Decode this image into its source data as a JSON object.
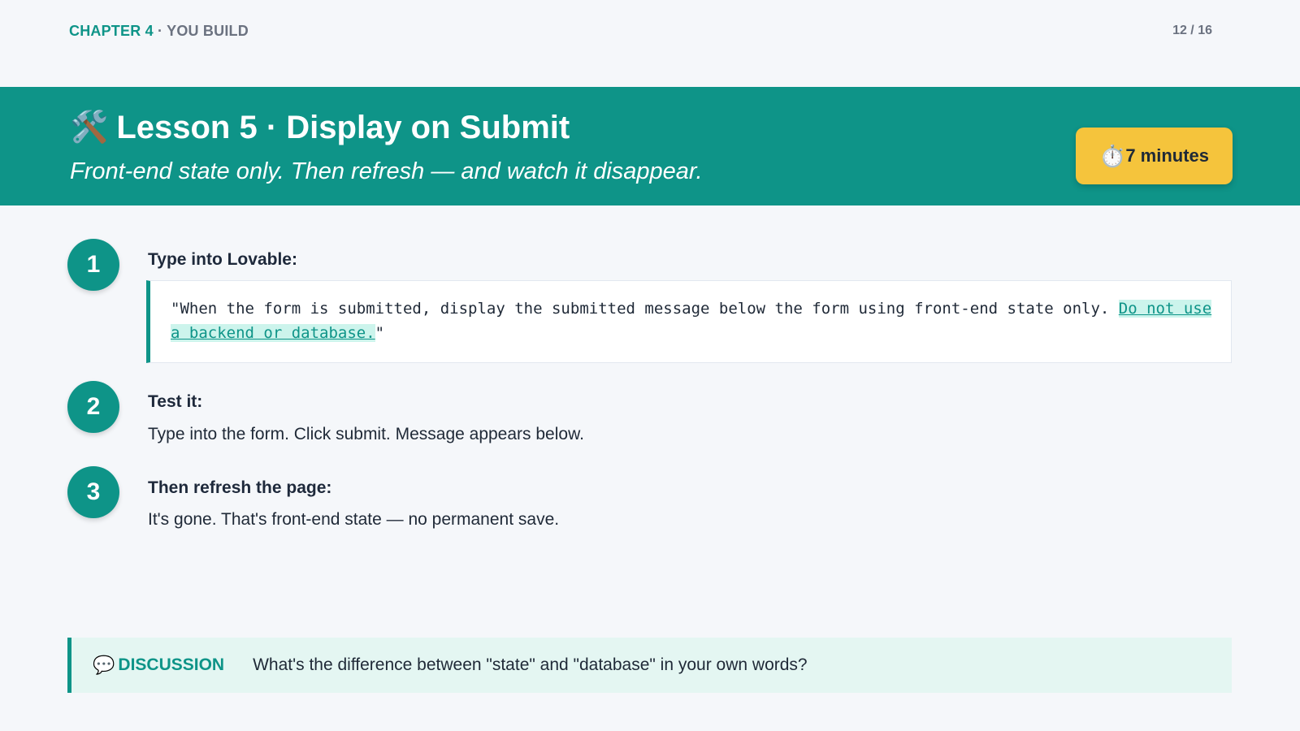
{
  "header": {
    "chapter": "CHAPTER 4",
    "separator": " · ",
    "section": "YOU BUILD",
    "page_indicator": "12 / 16"
  },
  "banner": {
    "icon": "hammer-and-wrench-icon",
    "icon_glyph": "🛠️",
    "title": "Lesson 5 · Display on Submit",
    "subtitle": "Front-end state only. Then refresh — and watch it disappear.",
    "timer": {
      "icon": "stopwatch-icon",
      "icon_glyph": "⏱️",
      "label": "7 minutes"
    }
  },
  "steps": [
    {
      "number": "1",
      "heading": "Type into Lovable:",
      "prompt_text": "\"When the form is submitted, display the submitted message below the form using front-end state only. ",
      "prompt_highlight": "Do not use a backend or database.",
      "prompt_end": "\""
    },
    {
      "number": "2",
      "heading": "Test it:",
      "text": "Type into the form. Click submit. Message appears below."
    },
    {
      "number": "3",
      "heading": "Then refresh the page:",
      "text": "It's gone. That's front-end state — no permanent save."
    }
  ],
  "discussion": {
    "icon": "speech-bubble-icon",
    "icon_glyph": "💬",
    "label": "DISCUSSION",
    "question": "What's the difference between \"state\" and \"database\" in your own words?"
  },
  "colors": {
    "accent": "#0e9488",
    "badge": "#f5c43c",
    "background": "#f5f7fa",
    "highlight_bg": "#ccf4ec",
    "discussion_bg": "#e4f6f2"
  }
}
